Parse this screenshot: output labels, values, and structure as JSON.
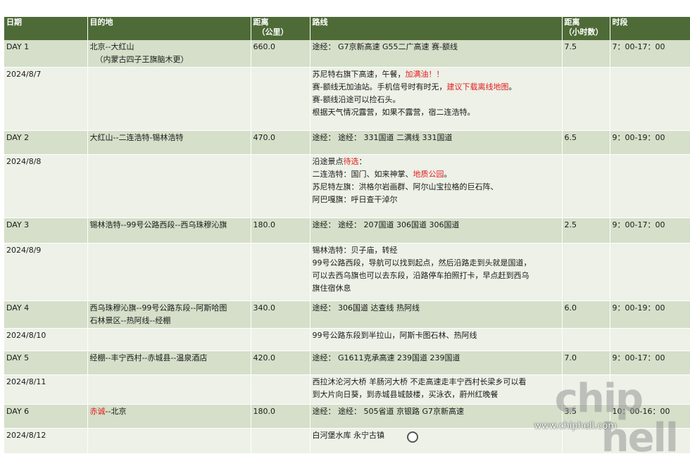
{
  "headers": {
    "date": "日期",
    "dest": "目的地",
    "dist": "距离（公里）",
    "route": "路线",
    "hours": "距离（小时数）",
    "time": "时段"
  },
  "days": [
    {
      "day": "DAY 1",
      "date": "2024/8/7",
      "dest_lines": [
        [
          {
            "t": "北京--大红山"
          }
        ],
        [
          {
            "t": "（内蒙古四子王旗脑木更）"
          }
        ]
      ],
      "dist": "660.0",
      "hours": "7.5",
      "time": "7：00-17：00",
      "route": "途经：  G7京新高速 G55二广高速 赛-额线",
      "notes": [
        [
          {
            "t": "苏尼特右旗下高速，午餐，"
          },
          {
            "t": "加满油！！",
            "red": true
          }
        ],
        [
          {
            "t": "赛-额线无加油站。手机信号时有时无，"
          },
          {
            "t": "建议下载离线地图",
            "red": true
          },
          {
            "t": "。"
          }
        ],
        [
          {
            "t": "赛-额线沿途可以捡石头。"
          }
        ],
        [
          {
            "t": "根据天气情况露营，如果不露营，宿二连浩特。"
          }
        ]
      ]
    },
    {
      "day": "DAY 2",
      "date": "2024/8/8",
      "dest_lines": [
        [
          {
            "t": "大红山--二连浩特-锡林浩特"
          }
        ]
      ],
      "dist": "470.0",
      "hours": "6.5",
      "time": "9：00-19：00",
      "route": "途经：  途经：  331国道 二满线 331国道",
      "notes": [
        [
          {
            "t": "沿途景点"
          },
          {
            "t": "待选",
            "red": true
          },
          {
            "t": "："
          }
        ],
        [
          {
            "t": "二连浩特：国门、如来神掌、"
          },
          {
            "t": "地质公园",
            "red": true
          },
          {
            "t": "。"
          }
        ],
        [
          {
            "t": "苏尼特左旗：洪格尔岩画群、阿尔山宝拉格的巨石阵、"
          }
        ],
        [
          {
            "t": "阿巴嘎旗：呼日查干淖尔"
          }
        ]
      ]
    },
    {
      "day": "DAY 3",
      "date": "2024/8/9",
      "dest_lines": [
        [
          {
            "t": "锡林浩特--99号公路西段--西乌珠穆沁旗"
          }
        ]
      ],
      "dist": "180.0",
      "hours": "2.5",
      "time": "9：00-17：00",
      "route": "途经：  途经：  207国道 306国道 306国道",
      "notes": [
        [
          {
            "t": "锡林浩特：贝子庙，转经"
          }
        ],
        [
          {
            "t": "99号公路西段，导航可以找到起点，然后沿路走到头就是国道，"
          }
        ],
        [
          {
            "t": "可以去西乌旗也可以去东段，沿路停车拍照打卡，早点赶到西乌"
          }
        ],
        [
          {
            "t": "旗住宿休息"
          }
        ]
      ]
    },
    {
      "day": "DAY 4",
      "date": "2024/8/10",
      "dest_lines": [
        [
          {
            "t": "西乌珠穆沁旗--99号公路东段--阿斯哈图"
          }
        ],
        [
          {
            "t": "石林景区--热阿线--经棚"
          }
        ]
      ],
      "dist": "340.0",
      "hours": "6.0",
      "time": "9：00-19：00",
      "route": "途经：  306国道 达查线 热阿线",
      "notes": [
        [
          {
            "t": "99号公路东段到半拉山，阿斯卡图石林、热阿线"
          }
        ]
      ]
    },
    {
      "day": "DAY 5",
      "date": "2024/8/11",
      "dest_lines": [
        [
          {
            "t": "经棚--丰宁西村--赤城县--温泉酒店"
          }
        ]
      ],
      "dist": "420.0",
      "hours": "7.0",
      "time": "9：00-17：00",
      "route": "途经：  G1611克承高速 239国道 239国道",
      "notes": [
        [
          {
            "t": "西拉沐沦河大桥  羊肠河大桥  不走高速走丰宁西村长梁乡可以看"
          }
        ],
        [
          {
            "t": "到大片向日葵，到赤城县城鼓楼，买泳衣，蔚州红晚餐"
          }
        ]
      ]
    },
    {
      "day": "DAY 6",
      "date": "2024/8/12",
      "dest_lines": [
        [
          {
            "t": "赤诚",
            "red": true
          },
          {
            "t": "--北京"
          }
        ]
      ],
      "dist": "180.0",
      "hours": "3.5",
      "time": "10：00-16：00",
      "route": "途经：  途经：  505省道 京银路 G7京新高速",
      "notes": [
        [
          {
            "t": "白河堡水库  永宁古镇"
          }
        ]
      ]
    }
  ],
  "watermark": {
    "logo": "chip hell",
    "url": "www.chiphell.com"
  },
  "colors": {
    "header_bg": "#4e6b37",
    "day_row_bg": "#d5dfc9",
    "date_row_bg": "#edf1e7",
    "highlight": "#e02020"
  }
}
